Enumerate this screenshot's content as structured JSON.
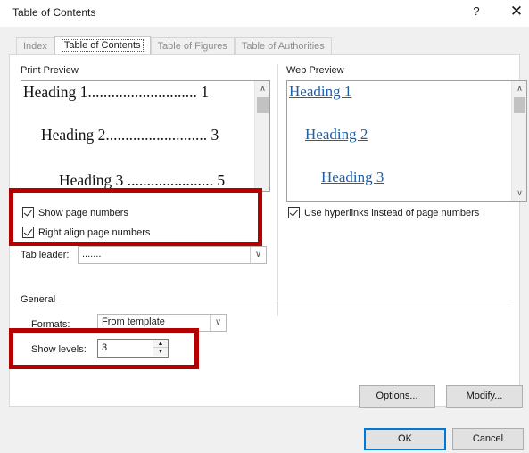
{
  "window": {
    "title": "Table of Contents",
    "help_glyph": "?",
    "close_glyph": "✕"
  },
  "tabs": [
    {
      "label": "Index",
      "active": false
    },
    {
      "label": "Table of Contents",
      "active": true
    },
    {
      "label": "Table of Figures",
      "active": false
    },
    {
      "label": "Table of Authorities",
      "active": false
    }
  ],
  "print_preview": {
    "label": "Print Preview",
    "lines": [
      "Heading 1............................ 1",
      "Heading 2.......................... 3",
      "Heading 3 ...................... 5"
    ]
  },
  "web_preview": {
    "label": "Web Preview",
    "lines": [
      "Heading 1",
      "Heading 2",
      "Heading 3"
    ]
  },
  "options": {
    "show_page_numbers": {
      "label": "Show page numbers",
      "checked": true
    },
    "right_align": {
      "label": "Right align page numbers",
      "checked": true
    },
    "use_hyperlinks": {
      "label": "Use hyperlinks instead of page numbers",
      "checked": true
    },
    "tab_leader": {
      "label": "Tab leader:",
      "value": "......."
    }
  },
  "general": {
    "label": "General",
    "formats_label": "Formats:",
    "formats_value": "From template",
    "show_levels_label": "Show levels:",
    "show_levels_value": "3"
  },
  "buttons": {
    "options": "Options...",
    "modify": "Modify...",
    "ok": "OK",
    "cancel": "Cancel"
  },
  "icons": {
    "scroll_up": "∧",
    "scroll_down": "∨",
    "dropdown": "∨",
    "spin_up": "▲",
    "spin_down": "▼"
  },
  "colors": {
    "annotation_red": "#b50000",
    "hyperlink_blue": "#1f5fa8",
    "default_button_border": "#0078d7"
  }
}
